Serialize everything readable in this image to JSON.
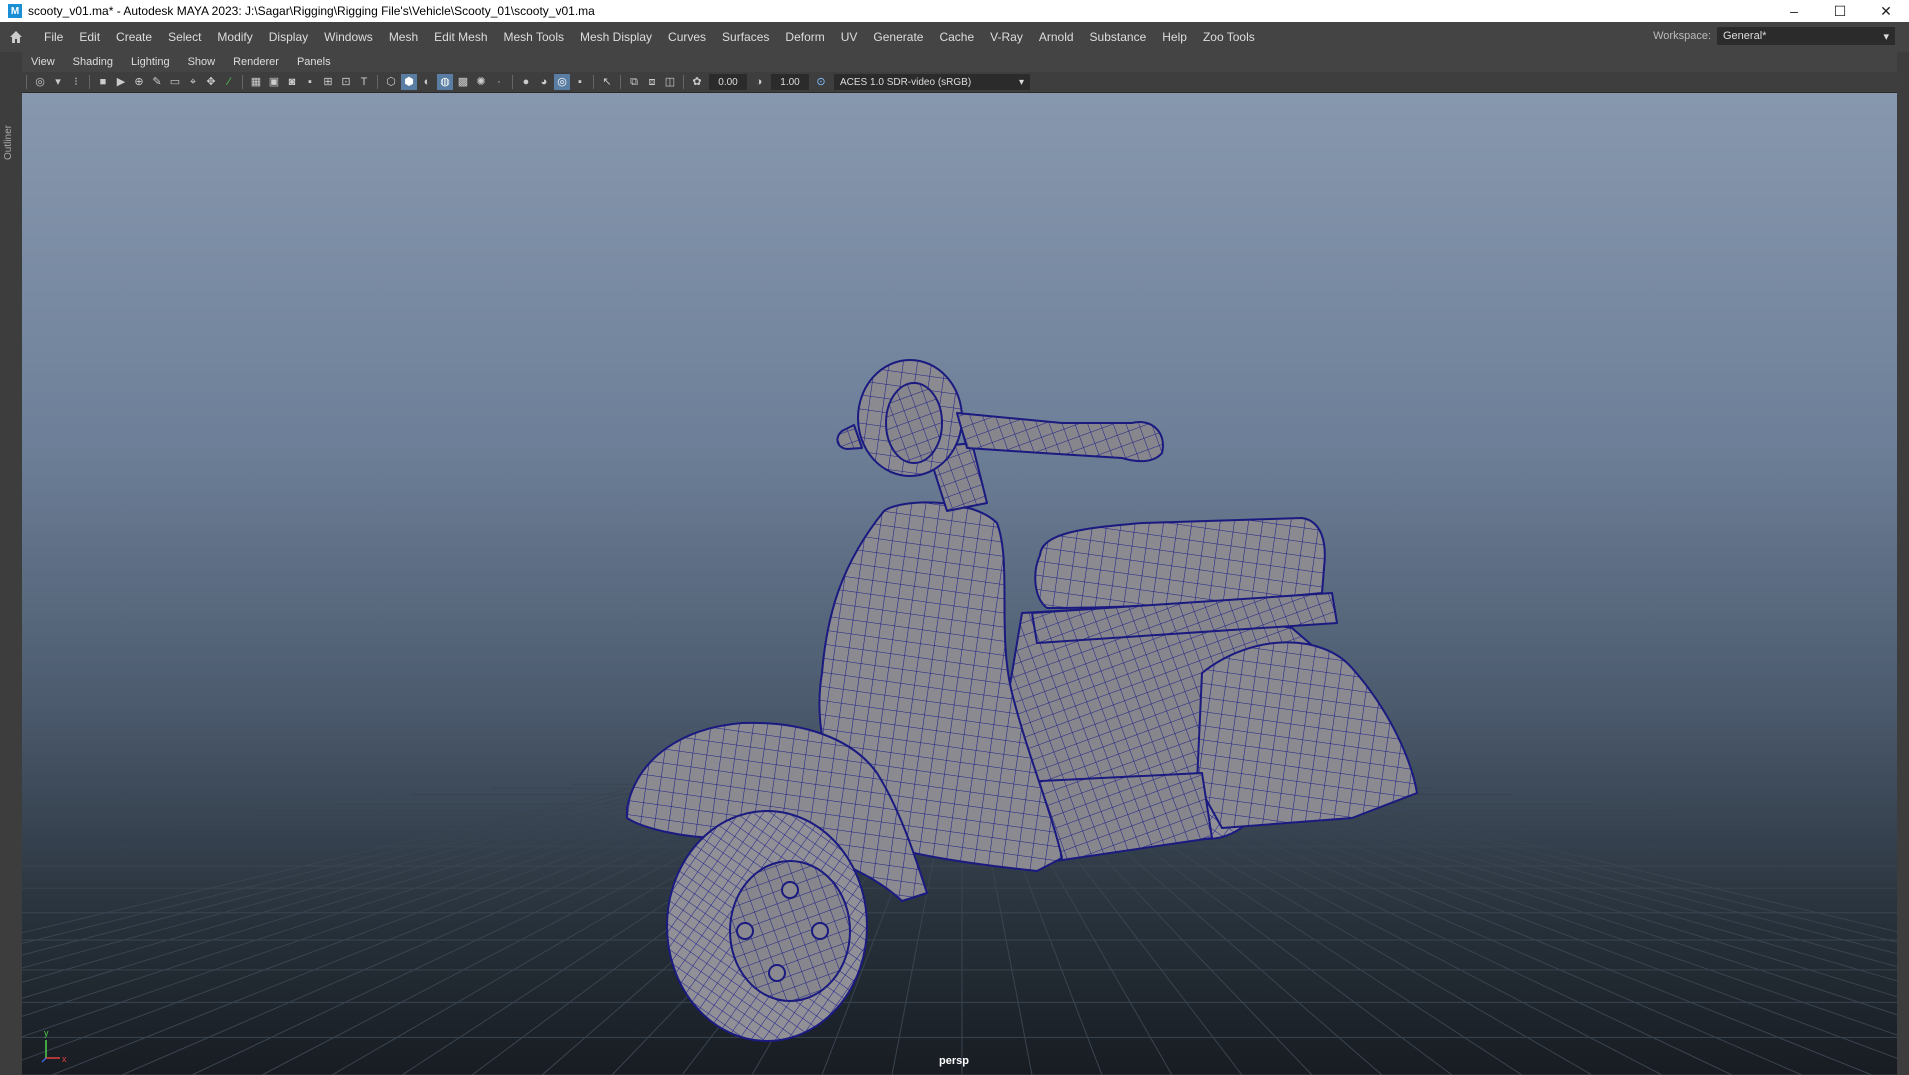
{
  "window": {
    "title": "scooty_v01.ma* - Autodesk MAYA 2023: J:\\Sagar\\Rigging\\Rigging File's\\Vehicle\\Scooty_01\\scooty_v01.ma",
    "app_icon": "M",
    "controls": {
      "minimize": "–",
      "maximize": "☐",
      "close": "✕"
    }
  },
  "menubar": {
    "items": [
      "File",
      "Edit",
      "Create",
      "Select",
      "Modify",
      "Display",
      "Windows",
      "Mesh",
      "Edit Mesh",
      "Mesh Tools",
      "Mesh Display",
      "Curves",
      "Surfaces",
      "Deform",
      "UV",
      "Generate",
      "Cache",
      "V-Ray",
      "Arnold",
      "Substance",
      "Help",
      "Zoo Tools"
    ],
    "workspace_label": "Workspace:",
    "workspace_value": "General*"
  },
  "outliner": {
    "label": "Outliner"
  },
  "panel_menu": {
    "items": [
      "View",
      "Shading",
      "Lighting",
      "Show",
      "Renderer",
      "Panels"
    ]
  },
  "toolbar": {
    "exposure": "0.00",
    "gamma": "1.00",
    "color_space": "ACES 1.0 SDR-video (sRGB)"
  },
  "viewport": {
    "camera": "persp",
    "axis_y": "y",
    "axis_x": "x",
    "colors": {
      "wireframe": "#1e1e8c",
      "mesh": "#8a8a8f",
      "grid": "#3a4450"
    }
  }
}
